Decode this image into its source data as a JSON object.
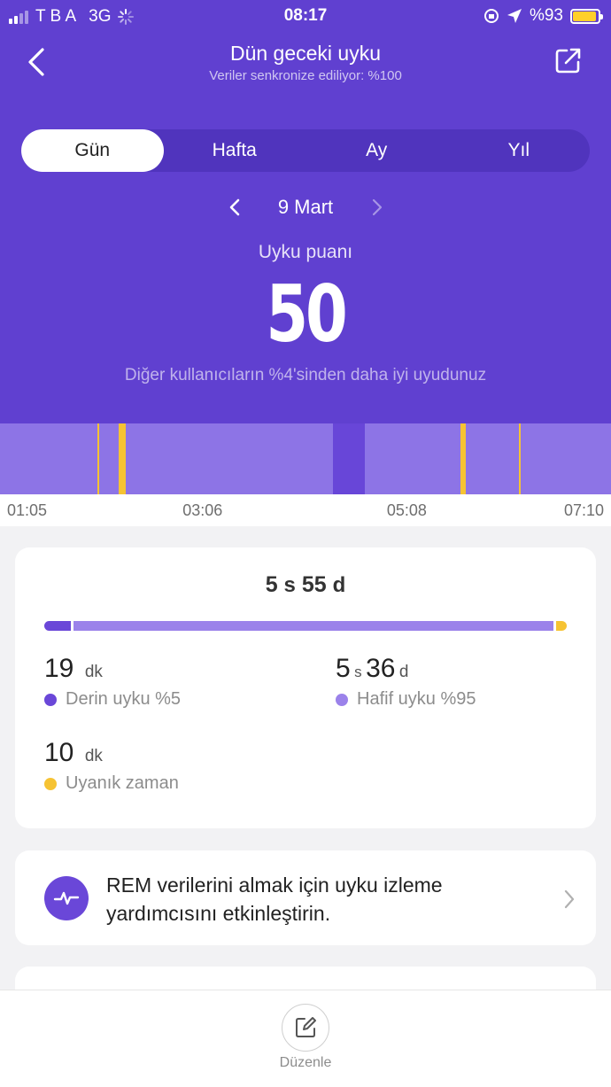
{
  "status_bar": {
    "carrier": "T B A",
    "network": "3G",
    "time": "08:17",
    "battery": "%93",
    "battery_fraction": 0.93
  },
  "header": {
    "title": "Dün geceki uyku",
    "subtitle": "Veriler senkronize ediliyor: %100",
    "back_icon": "chevron-left-icon",
    "share_icon": "share-icon"
  },
  "tabs": [
    {
      "label": "Gün",
      "active": true
    },
    {
      "label": "Hafta",
      "active": false
    },
    {
      "label": "Ay",
      "active": false
    },
    {
      "label": "Yıl",
      "active": false
    }
  ],
  "date_nav": {
    "label": "9 Mart"
  },
  "score": {
    "label": "Uyku puanı",
    "value": "50",
    "comparison": "Diğer kullanıcıların %4'sinden daha iyi uyudunuz"
  },
  "timeline": {
    "start": "01:05",
    "end": "07:10",
    "segments": [
      {
        "type": "light",
        "start": "01:05",
        "end": "02:03"
      },
      {
        "type": "awake",
        "start": "02:03",
        "end": "02:04"
      },
      {
        "type": "light",
        "start": "02:04",
        "end": "02:16"
      },
      {
        "type": "awake",
        "start": "02:16",
        "end": "02:20"
      },
      {
        "type": "light",
        "start": "02:20",
        "end": "04:24"
      },
      {
        "type": "deep",
        "start": "04:24",
        "end": "04:43"
      },
      {
        "type": "light",
        "start": "04:43",
        "end": "05:40"
      },
      {
        "type": "awake",
        "start": "05:40",
        "end": "05:43"
      },
      {
        "type": "light",
        "start": "05:43",
        "end": "06:15"
      },
      {
        "type": "awake",
        "start": "06:15",
        "end": "06:16"
      },
      {
        "type": "light",
        "start": "06:16",
        "end": "07:10"
      }
    ],
    "axis_labels": [
      "01:05",
      "03:06",
      "05:08",
      "07:10"
    ]
  },
  "summary": {
    "total_hours": "5",
    "total_h_unit": "s",
    "total_minutes": "55",
    "total_m_unit": "d",
    "distribution": [
      {
        "type": "deep",
        "fraction": 0.05
      },
      {
        "type": "light",
        "fraction": 0.925
      },
      {
        "type": "awake",
        "fraction": 0.025
      }
    ],
    "deep": {
      "value": "19",
      "unit": "dk",
      "label": "Derin uyku %5"
    },
    "light": {
      "hours": "5",
      "h_unit": "s",
      "minutes": "36",
      "m_unit": "d",
      "label": "Hafif uyku %95"
    },
    "awake": {
      "value": "10",
      "unit": "dk",
      "label": "Uyanık zaman"
    }
  },
  "colors": {
    "header_bg": "#6040d0",
    "deep": "#6a47d8",
    "light": "#9b82ea",
    "awake": "#f6c333",
    "timeline_light": "#8d74e6",
    "timeline_deep": "#6846d8"
  },
  "rem_prompt": {
    "text": "REM verilerini almak için uyku izleme yardımcısını etkinleştirin.",
    "icon": "heartbeat-icon"
  },
  "bottom_bar": {
    "edit_label": "Düzenle",
    "edit_icon": "edit-icon"
  }
}
